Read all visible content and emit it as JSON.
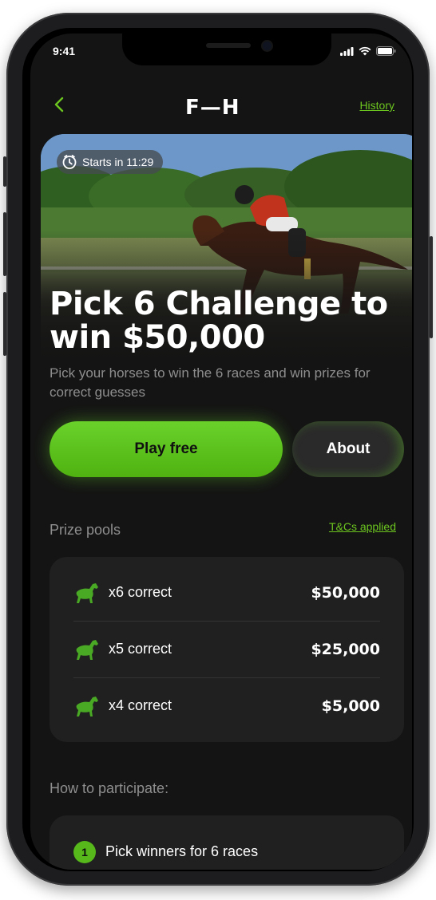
{
  "status_bar": {
    "time": "9:41"
  },
  "nav": {
    "logo": "F—H",
    "history_label": "History"
  },
  "hero": {
    "starts_label": "Starts in 11:29",
    "headline": "Pick 6 Challenge to win $50,000",
    "subtitle": "Pick your horses to win the 6 races and win prizes for correct guesses"
  },
  "actions": {
    "play_label": "Play free",
    "about_label": "About"
  },
  "prize_pools": {
    "title": "Prize pools",
    "tcs_label": "T&Cs applied",
    "rows": [
      {
        "label": "x6 correct",
        "amount": "$50,000"
      },
      {
        "label": "x5 correct",
        "amount": "$25,000"
      },
      {
        "label": "x4 correct",
        "amount": "$5,000"
      }
    ]
  },
  "how_to": {
    "title": "How to participate:",
    "steps": [
      {
        "number": "1",
        "text": "Pick winners for 6 races"
      }
    ]
  },
  "colors": {
    "accent": "#5fc41a",
    "background": "#141414",
    "card": "#202020",
    "muted_text": "#8e8e8e"
  },
  "icons": [
    "back-chevron-icon",
    "clock-icon",
    "horse-icon",
    "signal-icon",
    "wifi-icon",
    "battery-icon"
  ]
}
